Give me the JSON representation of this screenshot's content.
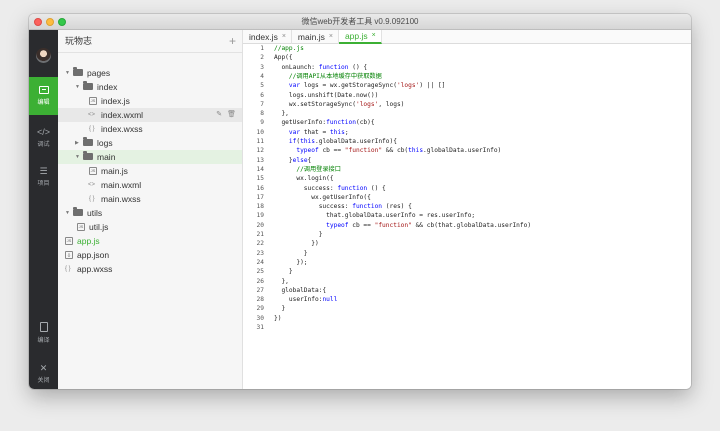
{
  "window": {
    "title": "微信web开发者工具 v0.9.092100"
  },
  "sidebar": {
    "items": [
      {
        "label": "编辑",
        "icon": "edit-icon"
      },
      {
        "label": "调试",
        "icon": "debug-icon"
      },
      {
        "label": "项目",
        "icon": "project-icon"
      },
      {
        "label": "编译",
        "icon": "compile-icon"
      },
      {
        "label": "关闭",
        "icon": "close-icon"
      }
    ],
    "colors": {
      "background": "#2a2b2e",
      "active": "#3cb034"
    }
  },
  "tree": {
    "title": "玩物志",
    "add_symbol": "+",
    "items": [
      {
        "label": "pages",
        "type": "folder",
        "open": true
      },
      {
        "label": "index",
        "type": "folder",
        "open": true
      },
      {
        "label": "index.js",
        "type": "js"
      },
      {
        "label": "index.wxml",
        "type": "wxml"
      },
      {
        "label": "index.wxss",
        "type": "wxss"
      },
      {
        "label": "logs",
        "type": "folder",
        "open": false
      },
      {
        "label": "main",
        "type": "folder",
        "open": true
      },
      {
        "label": "main.js",
        "type": "js"
      },
      {
        "label": "main.wxml",
        "type": "wxml"
      },
      {
        "label": "main.wxss",
        "type": "wxss"
      },
      {
        "label": "utils",
        "type": "folder",
        "open": true
      },
      {
        "label": "util.js",
        "type": "js"
      },
      {
        "label": "app.js",
        "type": "js"
      },
      {
        "label": "app.json",
        "type": "json"
      },
      {
        "label": "app.wxss",
        "type": "wxss"
      }
    ]
  },
  "tabs": [
    {
      "label": "index.js",
      "close": "×"
    },
    {
      "label": "main.js",
      "close": "×"
    },
    {
      "label": "app.js",
      "close": "×"
    }
  ],
  "editor": {
    "lines": [
      "//app.js",
      "App({",
      "  onLaunch: function () {",
      "    //调用API从本地缓存中获取数据",
      "    var logs = wx.getStorageSync('logs') || []",
      "    logs.unshift(Date.now())",
      "    wx.setStorageSync('logs', logs)",
      "  },",
      "  getUserInfo:function(cb){",
      "    var that = this;",
      "    if(this.globalData.userInfo){",
      "      typeof cb == \"function\" && cb(this.globalData.userInfo)",
      "    }else{",
      "      //调用登录接口",
      "      wx.login({",
      "        success: function () {",
      "          wx.getUserInfo({",
      "            success: function (res) {",
      "              that.globalData.userInfo = res.userInfo;",
      "              typeof cb == \"function\" && cb(that.globalData.userInfo)",
      "            }",
      "          })",
      "        }",
      "      });",
      "    }",
      "  },",
      "  globalData:{",
      "    userInfo:null",
      "  }",
      "})",
      ""
    ],
    "colors": {
      "keyword": "#0000ff",
      "comment": "#008000",
      "string": "#a31515",
      "text": "#222222"
    }
  }
}
